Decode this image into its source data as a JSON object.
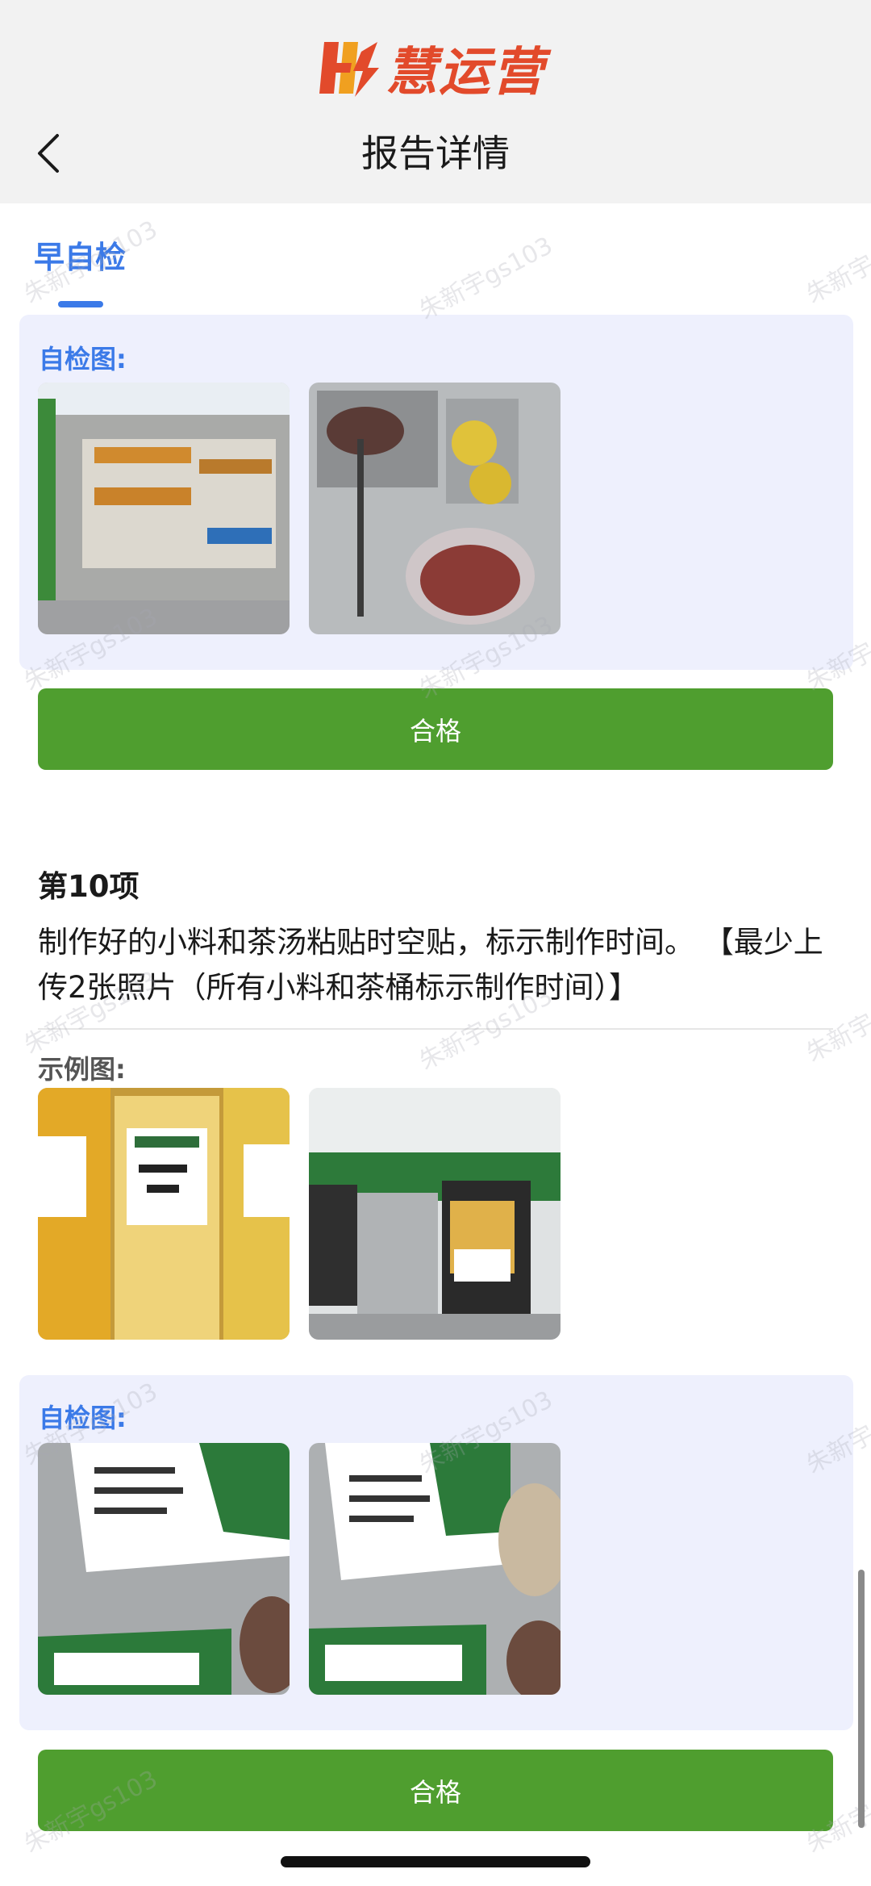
{
  "header": {
    "logo_text": "慧运营",
    "title": "报告详情",
    "back_icon": "chevron-left-icon"
  },
  "tab": {
    "label": "早自检"
  },
  "section_prev": {
    "self_check_label": "自检图:",
    "photos": [
      "display-case-pastries",
      "toppings-containers"
    ],
    "status_button": "合格"
  },
  "item10": {
    "number": "第10项",
    "description": "制作好的小料和茶汤粘贴时空贴，标示制作时间。 【最少上传2张照片（所有小料和茶桶标示制作时间）】",
    "example_label": "示例图:",
    "example_photos": [
      "labeled-juice-jugs",
      "tea-urns-with-labels"
    ],
    "self_check_label": "自检图:",
    "self_check_photos": [
      "label-sheet-photo-1",
      "label-sheet-photo-2"
    ],
    "status_button": "合格"
  },
  "watermark": "朱新宇gs103",
  "colors": {
    "accent": "#3b7ae8",
    "pass": "#4f9e2f",
    "panel_bg": "#eef0fd",
    "header_bg": "#f2f2f2",
    "logo": "#e24a2b"
  }
}
